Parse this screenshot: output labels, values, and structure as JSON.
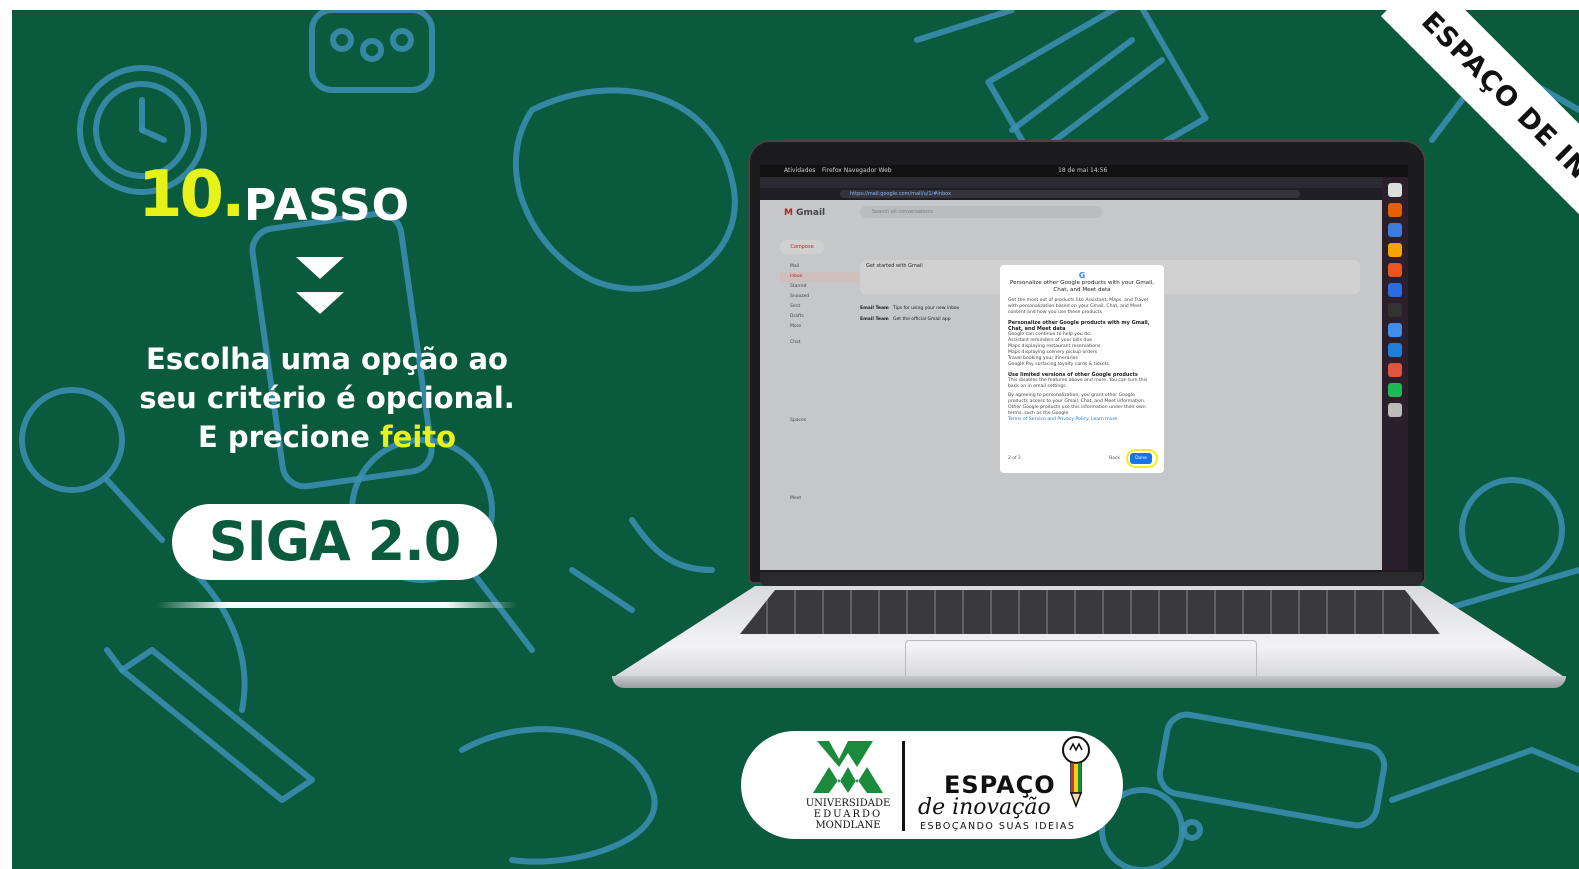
{
  "step": {
    "number": "10.",
    "word": "PASSO"
  },
  "instruction": {
    "line1": "Escolha uma opção ao",
    "line2": "seu critério é opcional.",
    "line3_prefix": "E precione ",
    "line3_highlight": "feito"
  },
  "badge": "SIGA 2.0",
  "ribbon": "ESPAÇO DE INOVAÇÃO",
  "colors": {
    "background": "#0a5a3e",
    "accent_yellow": "#e6f21a",
    "doodle_blue": "#3d8fb5",
    "ring": "#f2ee1b"
  },
  "screen": {
    "topbar_left": "Atividades",
    "topbar_app": "Firefox Navegador Web",
    "topbar_clock": "18 de mai 14:56",
    "url": "https://mail.google.com/mail/u/1/#inbox",
    "gmail_label": "Gmail",
    "search_placeholder": "Search all conversations",
    "compose": "Compose",
    "sidebar": [
      "Mail",
      "Inbox",
      "Starred",
      "Snoozed",
      "Sent",
      "Drafts",
      "More",
      "Chat",
      "Spaces",
      "Meet"
    ],
    "get_started": "Get started with Gmail",
    "rows": [
      {
        "sender": "Email Team",
        "subject": "Tips for using your new inbox"
      },
      {
        "sender": "Email Team",
        "subject": "Get the official Gmail app"
      }
    ],
    "modal": {
      "logo": "G",
      "title": "Personalize other Google products with your Gmail, Chat, and Meet data",
      "intro": "Get the most out of products like Assistant, Maps, and Travel with personalization based on your Gmail, Chat, and Meet content and how you use these products",
      "option1": "Personalize other Google products with my Gmail, Chat, and Meet data",
      "option1_note": "Google can continue to help you do:",
      "option1_bullets": [
        "Assistant reminders of your bills due",
        "Maps displaying restaurant reservations",
        "Maps displaying scenery pickup orders",
        "Travel booking your itineraries",
        "Google Pay surfacing loyalty cards & tickets"
      ],
      "option2": "Use limited versions of other Google products",
      "option2_note": "This disables the features above and more. You can turn this back on in email settings.",
      "legal": "By agreeing to personalization, you grant other Google products access to your Gmail, Chat, and Meet information. Other Google products use this information under their own terms, such as the Google",
      "links": "Terms of Service and Privacy Policy. Learn more",
      "page": "2 of 2",
      "back": "Back",
      "done": "Done"
    }
  },
  "logos": {
    "university": [
      "UNIVERSIDADE",
      "EDUARDO",
      "MONDLANE"
    ],
    "espaco_title": "ESPAÇO",
    "espaco_script": "de inovação",
    "espaco_tagline": "ESBOÇANDO SUAS IDEIAS"
  }
}
